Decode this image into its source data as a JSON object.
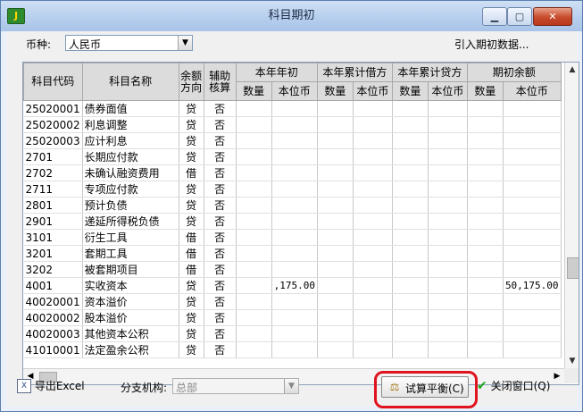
{
  "window": {
    "title": "科目期初",
    "min_glyph": "▁",
    "max_glyph": "▢",
    "close_glyph": "✕",
    "app_icon": "J"
  },
  "currency": {
    "label": "币种:",
    "value": "人民币"
  },
  "import_label": "引入期初数据...",
  "table": {
    "headers": {
      "code": "科目代码",
      "name": "科目名称",
      "direction": "余额方向",
      "aux": "辅助核算",
      "groups": [
        "本年年初",
        "本年累计借方",
        "本年累计贷方",
        "期初余额"
      ],
      "sub": [
        "数量",
        "本位币"
      ]
    },
    "rows": [
      {
        "code": "25020001",
        "name": "债券面值",
        "dir": "贷",
        "aux": "否",
        "amt1": "",
        "amt4": ""
      },
      {
        "code": "25020002",
        "name": "利息调整",
        "dir": "贷",
        "aux": "否",
        "amt1": "",
        "amt4": ""
      },
      {
        "code": "25020003",
        "name": "应计利息",
        "dir": "贷",
        "aux": "否",
        "amt1": "",
        "amt4": ""
      },
      {
        "code": "2701",
        "name": "长期应付款",
        "dir": "贷",
        "aux": "否",
        "amt1": "",
        "amt4": ""
      },
      {
        "code": "2702",
        "name": "未确认融资费用",
        "dir": "借",
        "aux": "否",
        "amt1": "",
        "amt4": ""
      },
      {
        "code": "2711",
        "name": "专项应付款",
        "dir": "贷",
        "aux": "否",
        "amt1": "",
        "amt4": ""
      },
      {
        "code": "2801",
        "name": "预计负债",
        "dir": "贷",
        "aux": "否",
        "amt1": "",
        "amt4": ""
      },
      {
        "code": "2901",
        "name": "递延所得税负债",
        "dir": "贷",
        "aux": "否",
        "amt1": "",
        "amt4": ""
      },
      {
        "code": "3101",
        "name": "衍生工具",
        "dir": "借",
        "aux": "否",
        "amt1": "",
        "amt4": ""
      },
      {
        "code": "3201",
        "name": "套期工具",
        "dir": "借",
        "aux": "否",
        "amt1": "",
        "amt4": ""
      },
      {
        "code": "3202",
        "name": "被套期项目",
        "dir": "借",
        "aux": "否",
        "amt1": "",
        "amt4": ""
      },
      {
        "code": "4001",
        "name": "实收资本",
        "dir": "贷",
        "aux": "否",
        "amt1": ",175.00",
        "amt4": "50,175.00"
      },
      {
        "code": "40020001",
        "name": "资本溢价",
        "dir": "贷",
        "aux": "否",
        "amt1": "",
        "amt4": ""
      },
      {
        "code": "40020002",
        "name": "股本溢价",
        "dir": "贷",
        "aux": "否",
        "amt1": "",
        "amt4": ""
      },
      {
        "code": "40020003",
        "name": "其他资本公积",
        "dir": "贷",
        "aux": "否",
        "amt1": "",
        "amt4": ""
      },
      {
        "code": "41010001",
        "name": "法定盈余公积",
        "dir": "贷",
        "aux": "否",
        "amt1": "",
        "amt4": ""
      }
    ]
  },
  "bottom": {
    "export_label": "导出Excel",
    "branch_label": "分支机构:",
    "branch_value": "总部",
    "balance_label": "试算平衡(C)",
    "close_label": "关闭窗口(Q)"
  }
}
